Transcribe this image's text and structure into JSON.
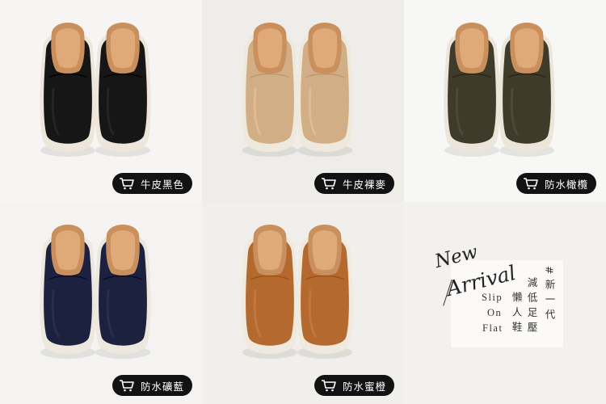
{
  "products": [
    {
      "label": "牛皮黑色",
      "color": "#161616",
      "sole": "#ece6db"
    },
    {
      "label": "牛皮裸麥",
      "color": "#d2ae86",
      "sole": "#efe8dc"
    },
    {
      "label": "防水橄欖",
      "color": "#3f3b2b",
      "sole": "#ebe5da"
    },
    {
      "label": "防水礦藍",
      "color": "#1d2140",
      "sole": "#ede8de"
    },
    {
      "label": "防水蜜橙",
      "color": "#b4692f",
      "sole": "#efe9de"
    }
  ],
  "promo": {
    "new": "New",
    "arrival": "Arrival",
    "eng_lines": [
      "Slip",
      "On",
      "Flat"
    ],
    "cols": [
      "懶人鞋",
      "減低足壓",
      "#新一代"
    ]
  },
  "icons": {
    "badge_icon": "shopping-cart-icon"
  }
}
